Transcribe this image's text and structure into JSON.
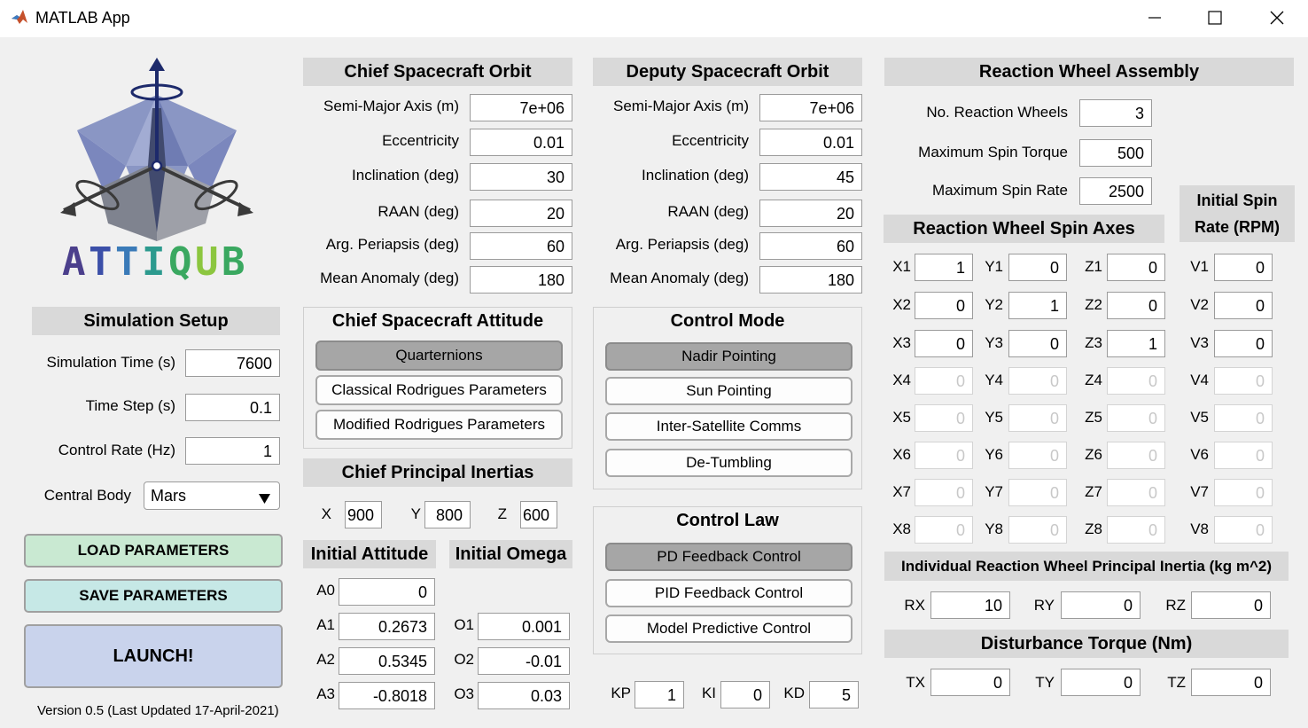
{
  "window": {
    "title": "MATLAB App"
  },
  "logo": {
    "text": "ATTIQUB",
    "colors": [
      "#4b3f8c",
      "#3b4fa8",
      "#3a7ab8",
      "#2c9a8e",
      "#3aa860",
      "#8cc63f",
      "#3aa860"
    ]
  },
  "sim": {
    "header": "Simulation Setup",
    "time_label": "Simulation Time (s)",
    "time_value": "7600",
    "step_label": "Time Step (s)",
    "step_value": "0.1",
    "rate_label": "Control Rate (Hz)",
    "rate_value": "1",
    "body_label": "Central Body",
    "body_value": "Mars"
  },
  "buttons": {
    "load": "LOAD PARAMETERS",
    "save": "SAVE PARAMETERS",
    "launch": "LAUNCH!"
  },
  "version": "Version 0.5 (Last Updated 17-April-2021)",
  "chief_orbit": {
    "header": "Chief Spacecraft Orbit",
    "rows": [
      {
        "label": "Semi-Major Axis (m)",
        "value": "7e+06"
      },
      {
        "label": "Eccentricity",
        "value": "0.01"
      },
      {
        "label": "Inclination (deg)",
        "value": "30"
      },
      {
        "label": "RAAN (deg)",
        "value": "20"
      },
      {
        "label": "Arg. Periapsis (deg)",
        "value": "60"
      },
      {
        "label": "Mean Anomaly (deg)",
        "value": "180"
      }
    ]
  },
  "deputy_orbit": {
    "header": "Deputy Spacecraft Orbit",
    "rows": [
      {
        "label": "Semi-Major Axis (m)",
        "value": "7e+06"
      },
      {
        "label": "Eccentricity",
        "value": "0.01"
      },
      {
        "label": "Inclination (deg)",
        "value": "45"
      },
      {
        "label": "RAAN (deg)",
        "value": "20"
      },
      {
        "label": "Arg. Periapsis (deg)",
        "value": "60"
      },
      {
        "label": "Mean Anomaly (deg)",
        "value": "180"
      }
    ]
  },
  "attitude": {
    "header": "Chief Spacecraft Attitude",
    "options": [
      "Quarternions",
      "Classical Rodrigues Parameters",
      "Modified Rodrigues Parameters"
    ],
    "selected": "Quarternions"
  },
  "inertia": {
    "header": "Chief Principal Inertias",
    "x_label": "X",
    "x_value": "900",
    "y_label": "Y",
    "y_value": "800",
    "z_label": "Z",
    "z_value": "600"
  },
  "initial_attitude": {
    "header": "Initial Attitude",
    "rows": [
      {
        "label": "A0",
        "value": "0"
      },
      {
        "label": "A1",
        "value": "0.2673"
      },
      {
        "label": "A2",
        "value": "0.5345"
      },
      {
        "label": "A3",
        "value": "-0.8018"
      }
    ]
  },
  "initial_omega": {
    "header": "Initial Omega",
    "rows": [
      {
        "label": "O1",
        "value": "0.001"
      },
      {
        "label": "O2",
        "value": "-0.01"
      },
      {
        "label": "O3",
        "value": "0.03"
      }
    ]
  },
  "control_mode": {
    "header": "Control Mode",
    "options": [
      "Nadir Pointing",
      "Sun Pointing",
      "Inter-Satellite Comms",
      "De-Tumbling"
    ],
    "selected": "Nadir Pointing"
  },
  "control_law": {
    "header": "Control Law",
    "options": [
      "PD Feedback Control",
      "PID Feedback Control",
      "Model Predictive Control"
    ],
    "selected": "PD Feedback Control"
  },
  "gains": {
    "kp_label": "KP",
    "kp": "1",
    "ki_label": "KI",
    "ki": "0",
    "kd_label": "KD",
    "kd": "5"
  },
  "rwa": {
    "header": "Reaction Wheel Assembly",
    "count_label": "No. Reaction Wheels",
    "count_value": "3",
    "torque_label": "Maximum Spin Torque",
    "torque_value": "500",
    "rate_label": "Maximum Spin Rate",
    "rate_value": "2500"
  },
  "spin_axes": {
    "header": "Reaction Wheel Spin Axes",
    "rows": [
      {
        "x_label": "X1",
        "x": "1",
        "y_label": "Y1",
        "y": "0",
        "z_label": "Z1",
        "z": "0",
        "v_label": "V1",
        "v": "0",
        "enabled": true
      },
      {
        "x_label": "X2",
        "x": "0",
        "y_label": "Y2",
        "y": "1",
        "z_label": "Z2",
        "z": "0",
        "v_label": "V2",
        "v": "0",
        "enabled": true
      },
      {
        "x_label": "X3",
        "x": "0",
        "y_label": "Y3",
        "y": "0",
        "z_label": "Z3",
        "z": "1",
        "v_label": "V3",
        "v": "0",
        "enabled": true
      },
      {
        "x_label": "X4",
        "x": "0",
        "y_label": "Y4",
        "y": "0",
        "z_label": "Z4",
        "z": "0",
        "v_label": "V4",
        "v": "0",
        "enabled": false
      },
      {
        "x_label": "X5",
        "x": "0",
        "y_label": "Y5",
        "y": "0",
        "z_label": "Z5",
        "z": "0",
        "v_label": "V5",
        "v": "0",
        "enabled": false
      },
      {
        "x_label": "X6",
        "x": "0",
        "y_label": "Y6",
        "y": "0",
        "z_label": "Z6",
        "z": "0",
        "v_label": "V6",
        "v": "0",
        "enabled": false
      },
      {
        "x_label": "X7",
        "x": "0",
        "y_label": "Y7",
        "y": "0",
        "z_label": "Z7",
        "z": "0",
        "v_label": "V7",
        "v": "0",
        "enabled": false
      },
      {
        "x_label": "X8",
        "x": "0",
        "y_label": "Y8",
        "y": "0",
        "z_label": "Z8",
        "z": "0",
        "v_label": "V8",
        "v": "0",
        "enabled": false
      }
    ]
  },
  "spin_rate": {
    "header_line1": "Initial Spin",
    "header_line2": "Rate (RPM)"
  },
  "wheel_inertia": {
    "header": "Individual Reaction Wheel Principal Inertia (kg m^2)",
    "rx_label": "RX",
    "rx": "10",
    "ry_label": "RY",
    "ry": "0",
    "rz_label": "RZ",
    "rz": "0"
  },
  "disturbance": {
    "header": "Disturbance Torque (Nm)",
    "tx_label": "TX",
    "tx": "0",
    "ty_label": "TY",
    "ty": "0",
    "tz_label": "TZ",
    "tz": "0"
  }
}
